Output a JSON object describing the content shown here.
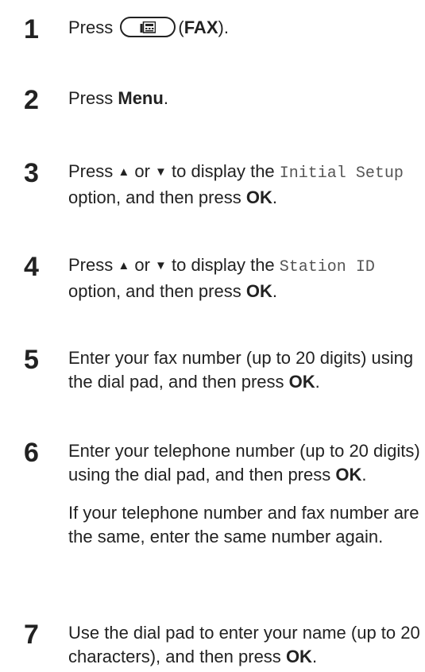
{
  "steps": [
    {
      "number": "1",
      "press": "Press",
      "fax_label": "FAX"
    },
    {
      "number": "2",
      "press": "Press",
      "menu_label": "Menu",
      "end": "."
    },
    {
      "number": "3",
      "press": "Press",
      "up_arrow": "▲",
      "or": "or",
      "down_arrow": "▼",
      "to_display": "to display the",
      "option_code": "Initial Setup",
      "option_rest": "option, and then press",
      "ok": "OK"
    },
    {
      "number": "4",
      "press": "Press",
      "up_arrow": "▲",
      "or": "or",
      "down_arrow": "▼",
      "to_display": "to display the",
      "option_code": "Station ID",
      "option_rest": "option, and then press",
      "ok": "OK"
    },
    {
      "number": "5",
      "text": "Enter your fax number (up to 20 digits) using the dial pad, and then press",
      "ok": "OK"
    },
    {
      "number": "6",
      "text": "Enter your telephone number (up to 20 digits) using the dial pad, and then press",
      "ok": "OK",
      "note": "If your telephone number and fax number are the same, enter the same number again."
    },
    {
      "number": "7",
      "text": "Use the dial pad to enter your name (up to 20 characters), and then press",
      "ok": "OK"
    }
  ],
  "icons": {
    "fax_key": "fax-key-icon"
  }
}
